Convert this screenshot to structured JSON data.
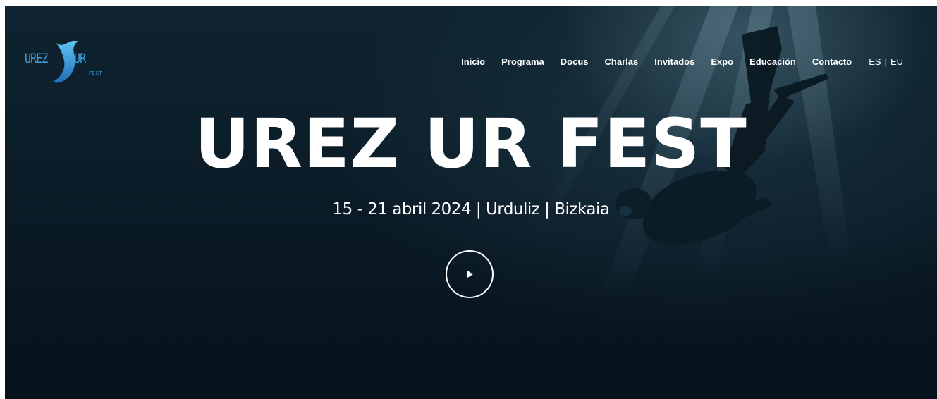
{
  "brand": {
    "logo_left": "UREZ",
    "logo_right": "UR",
    "logo_sub": "FEST",
    "logo_color": "#3aa0e0"
  },
  "nav": {
    "items": [
      {
        "label": "Inicio"
      },
      {
        "label": "Programa"
      },
      {
        "label": "Docus"
      },
      {
        "label": "Charlas"
      },
      {
        "label": "Invitados"
      },
      {
        "label": "Expo"
      },
      {
        "label": "Educación"
      },
      {
        "label": "Contacto"
      }
    ],
    "lang": {
      "es": "ES",
      "separator": "|",
      "eu": "EU"
    }
  },
  "hero": {
    "title": "UREZ UR FEST",
    "subtitle": "15 - 21 abril 2024 | Urduliz | Bizkaia",
    "play_icon": "play-icon",
    "background_color": "#0b1c28"
  }
}
